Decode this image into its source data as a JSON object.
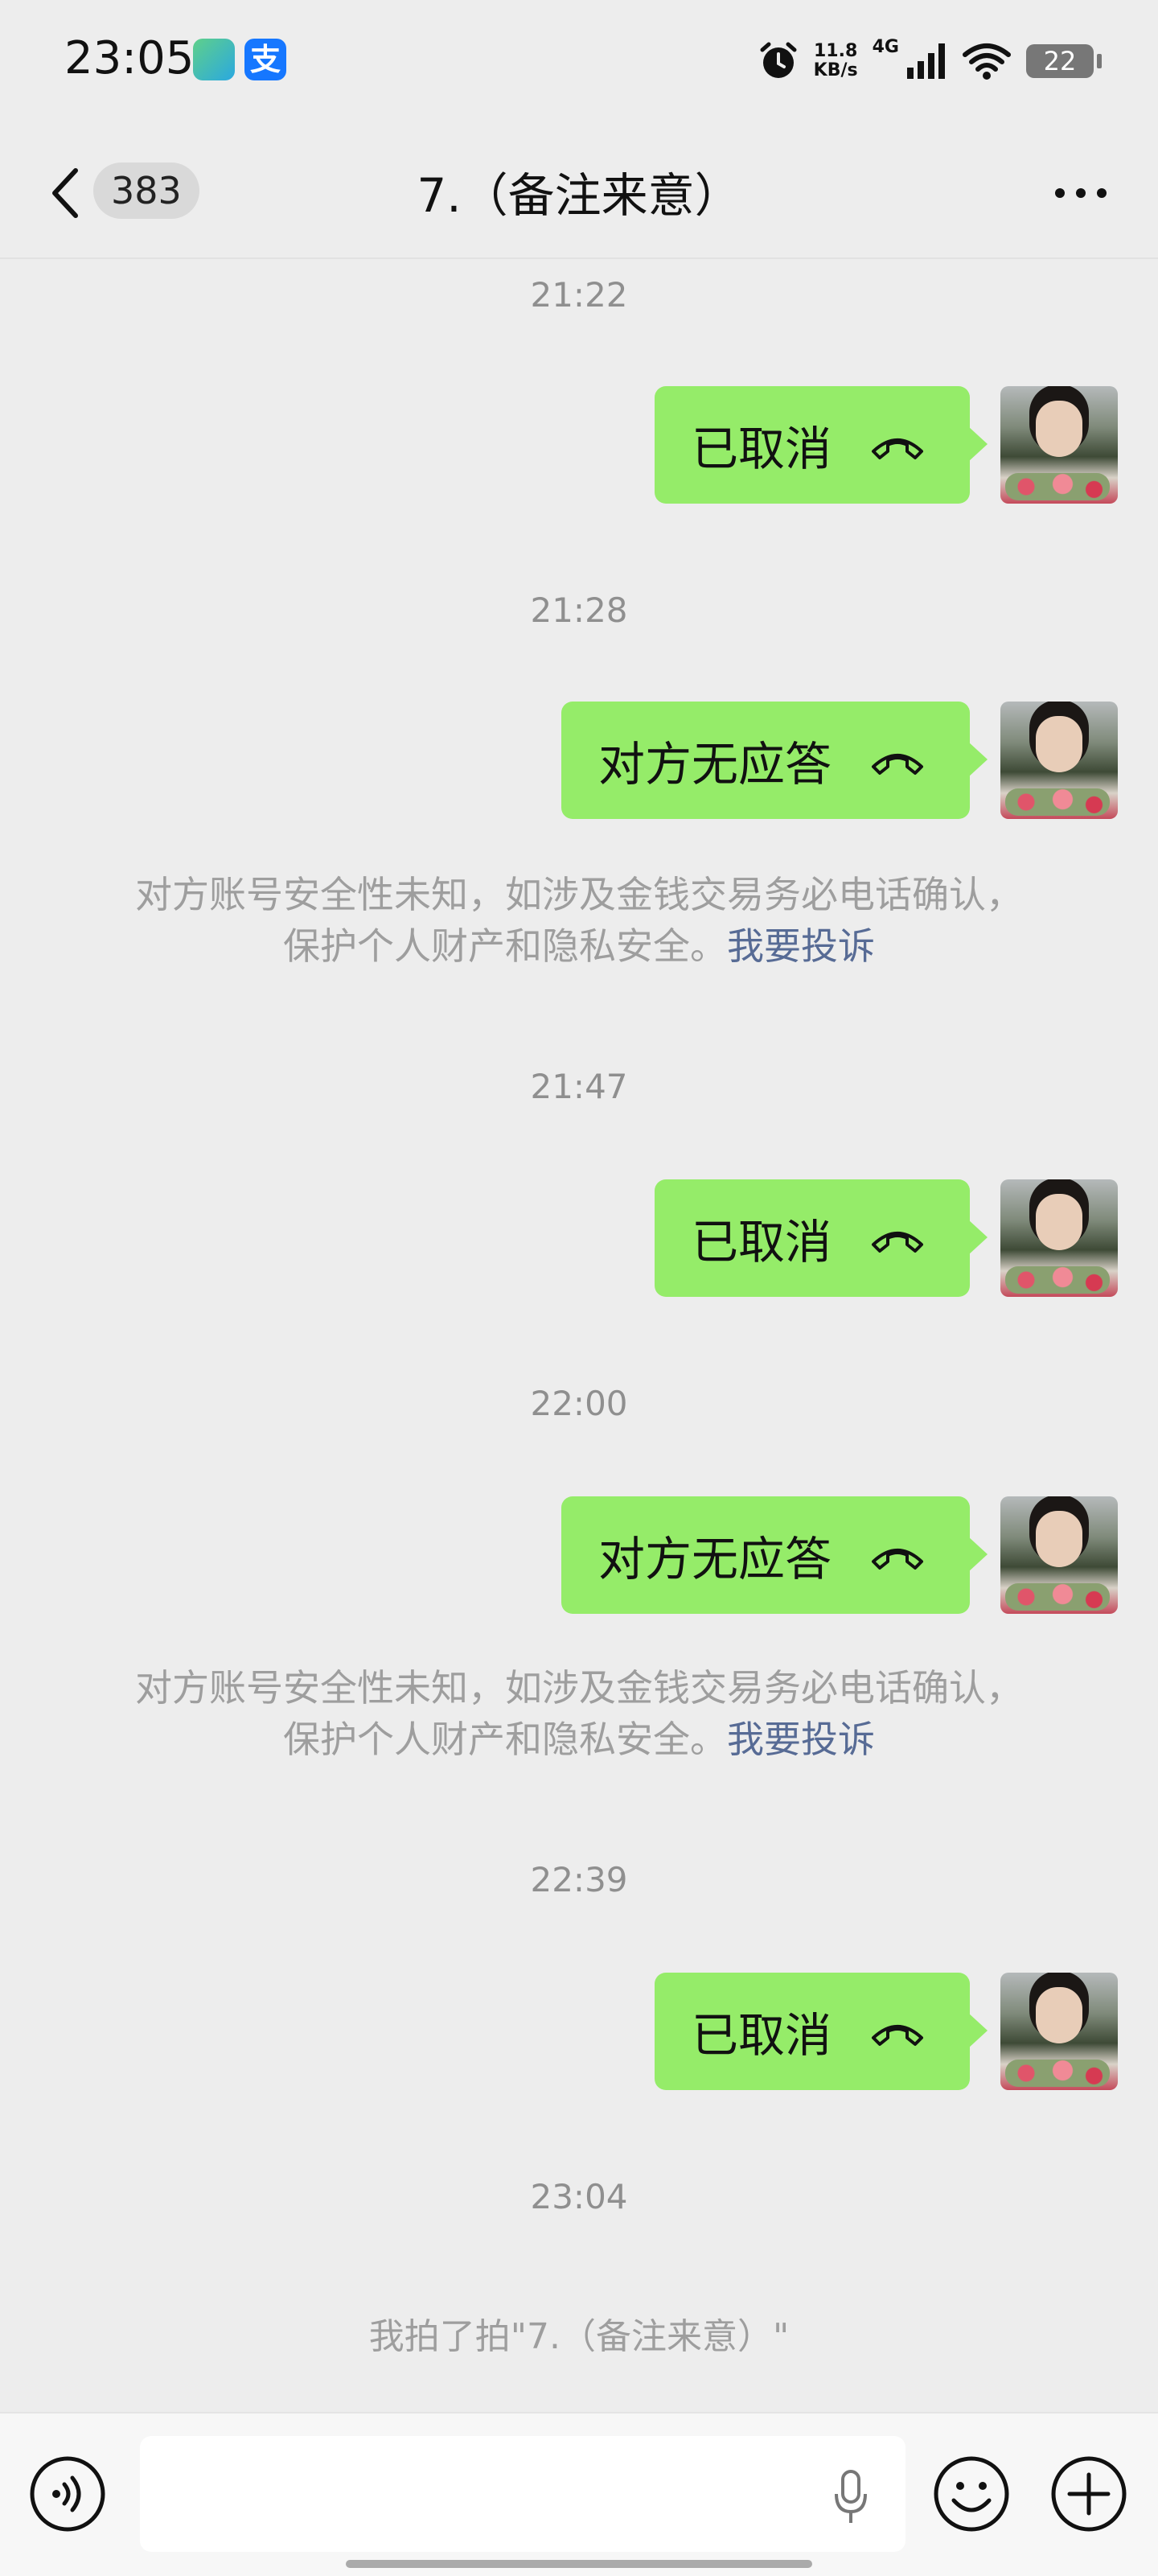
{
  "status_bar": {
    "time": "23:05",
    "app_icon_2_label": "支",
    "net_speed_value": "11.8",
    "net_speed_unit": "KB/s",
    "network": "4G",
    "battery": "22"
  },
  "nav": {
    "unread_count": "383",
    "title": "7.（备注来意）"
  },
  "timestamps": [
    "21:22",
    "21:28",
    "21:47",
    "22:00",
    "22:39",
    "23:04"
  ],
  "messages": [
    {
      "text": "已取消"
    },
    {
      "text": "对方无应答"
    },
    {
      "text": "已取消"
    },
    {
      "text": "对方无应答"
    },
    {
      "text": "已取消"
    }
  ],
  "notices": [
    {
      "line1": "对方账号安全性未知，如涉及金钱交易务必电话确认，",
      "line2": "保护个人财产和隐私安全。",
      "link": "我要投诉"
    },
    {
      "line1": "对方账号安全性未知，如涉及金钱交易务必电话确认，",
      "line2": "保护个人财产和隐私安全。",
      "link": "我要投诉"
    }
  ],
  "pat_message": "我拍了拍\"7.（备注来意）\"",
  "colors": {
    "bubble": "#95ec69",
    "background": "#ededed",
    "link": "#576b95"
  },
  "icons": [
    "back-arrow",
    "more-dots",
    "phone-hangup",
    "voice",
    "mic",
    "emoji",
    "plus"
  ]
}
